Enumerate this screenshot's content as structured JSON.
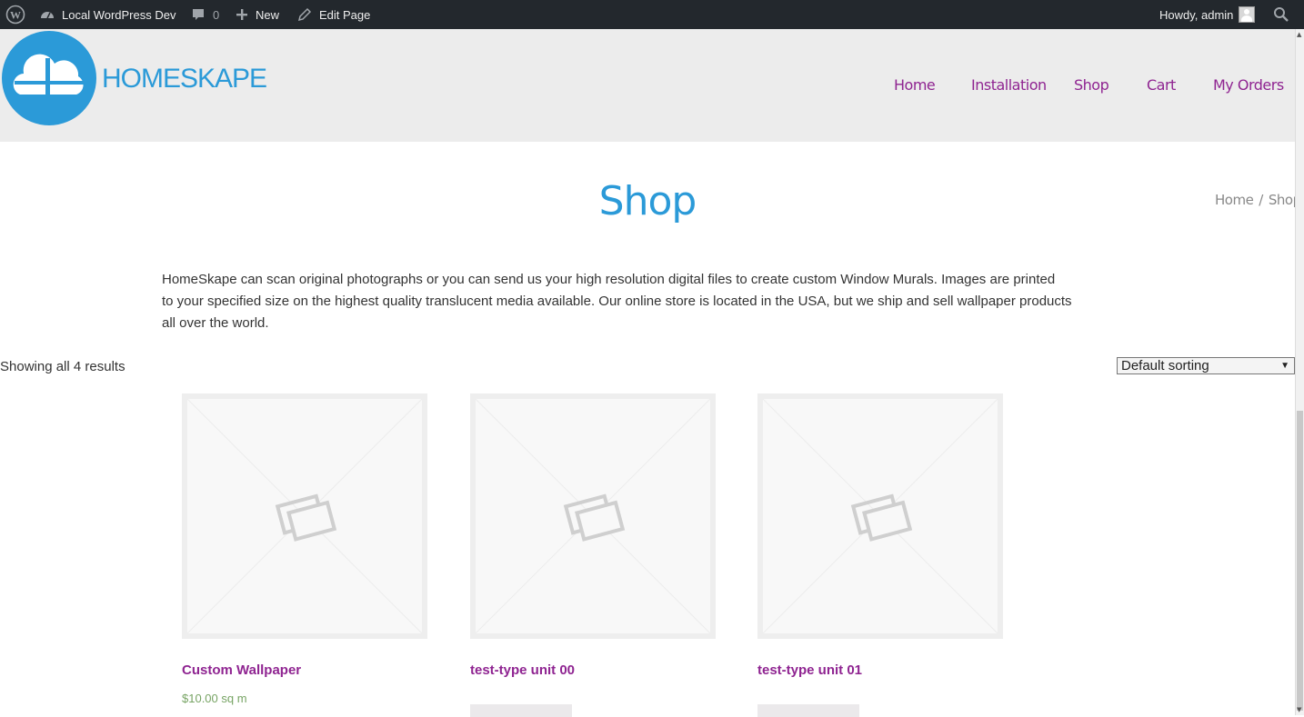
{
  "admin_bar": {
    "site_name": "Local WordPress Dev",
    "comments_count": "0",
    "new_label": "New",
    "edit_label": "Edit Page",
    "howdy": "Howdy, admin"
  },
  "header": {
    "logo_text": "HOMESKAPE",
    "brand_color": "#2b9ad8",
    "nav": [
      "Home",
      "Installation",
      "Shop",
      "Cart",
      "My Orders"
    ],
    "nav_color": "#8f2491"
  },
  "page": {
    "title": "Shop",
    "breadcrumb": [
      "Home",
      "Shop"
    ],
    "breadcrumb_sep": "/",
    "intro_lines": [
      "HomeSkape can scan original photographs or you can send us your high resolution digital files to create custom Window Murals. Images are printed",
      "to your specified size on the highest quality translucent media available. Our online store is located in the USA, but we ship and sell wallpaper products",
      "all over the world."
    ],
    "result_count": "Showing all 4 results",
    "sorting": "Default sorting"
  },
  "products": [
    {
      "name": "Custom Wallpaper",
      "price": "$10.00 sq m"
    },
    {
      "name": "test-type unit 00",
      "price": ""
    },
    {
      "name": "test-type unit 01",
      "price": ""
    }
  ]
}
